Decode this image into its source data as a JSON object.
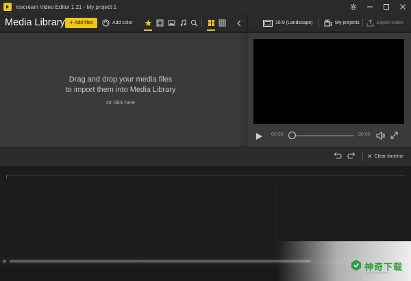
{
  "window": {
    "title": "Icecream Video Editor 1.21 - My project 1"
  },
  "toolbar": {
    "media_library_title": "Media Library",
    "add_files_label": "Add files",
    "add_color_label": "Add color",
    "aspect_ratio_label": "16:9 (Landscape)",
    "my_projects_label": "My projects",
    "export_video_label": "Export video"
  },
  "media_panel": {
    "drop_line1": "Drag and drop your media files",
    "drop_line2": "to import them into Media Library",
    "click_here": "Or click here"
  },
  "player": {
    "current_time": "00:00",
    "total_time": "00:00",
    "seek_position": 0
  },
  "timeline": {
    "clear_label": "Clear timeline"
  },
  "watermark": {
    "text": "神奇下载",
    "sub": "www.sqxz.com"
  },
  "colors": {
    "accent": "#f2c513",
    "panel": "#3a3a3a",
    "timeline": "#1c1c1c"
  },
  "icons": {
    "active_filter": "star-icon",
    "active_view": "grid-view-icon"
  }
}
